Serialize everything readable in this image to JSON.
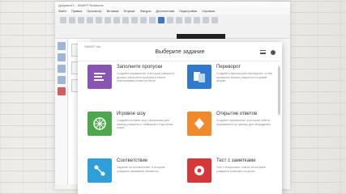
{
  "app": {
    "title": "Документ1 - SMART Notebook",
    "menu": [
      "Файл",
      "Правка",
      "Просмотр",
      "Вставка",
      "Формат",
      "Фигуры",
      "Дополнения",
      "Надстройки",
      "Справка"
    ]
  },
  "dialog": {
    "title": "Выберите задание",
    "small_label": "SMART lab",
    "cards": [
      {
        "name": "Заполните пропуски",
        "desc": "Создайте упражнение, в котором учащиеся должны заполнить пропуски в тексте, перетаскивая слова на место.",
        "color": "#8a54b5",
        "icon": "text-lines-icon"
      },
      {
        "name": "Переворот",
        "desc": "Создайте карточки для переворота, чтобы проверять знания учащихся в игровой форме.",
        "color": "#2f7ad0",
        "icon": "flip-card-icon"
      },
      {
        "name": "Игровое шоу",
        "desc": "Создайте игровое шоу с вопросами для команд учащихся с таймером и подсчётом очков.",
        "color": "#4ca84a",
        "icon": "wheel-icon"
      },
      {
        "name": "Открытие ответов",
        "desc": "Создайте упражнение, в котором ответы открываются по одному для обсуждения.",
        "color": "#f08a2a",
        "icon": "reveal-icon"
      },
      {
        "name": "Соответствие",
        "desc": "Задание на соответствие, в котором учащиеся связывают элементы.",
        "color": "#2d9fd9",
        "icon": "match-icon"
      },
      {
        "name": "Тест с заметками",
        "desc": "Тест с вопросами, ответы на которые учащиеся отмечают на доске.",
        "color": "#d8373a",
        "icon": "quiz-icon"
      }
    ]
  }
}
